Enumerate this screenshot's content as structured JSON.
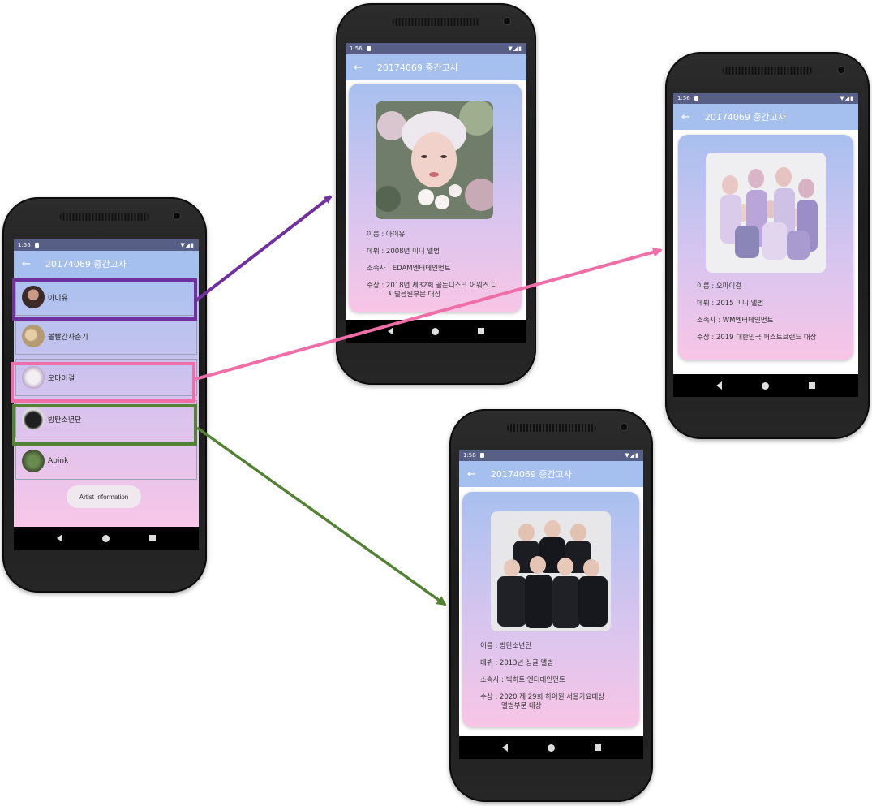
{
  "main": {
    "status_time": "1:56",
    "title": "20174069 중간고사",
    "items": [
      {
        "label": "아이유"
      },
      {
        "label": "볼빨간사춘기"
      },
      {
        "label": "오마이걸"
      },
      {
        "label": "방탄소년단"
      },
      {
        "label": "Apink"
      }
    ],
    "button_label": "Artist Information"
  },
  "detail_iu": {
    "status_time": "1:56",
    "title": "20174069 중간고사",
    "name": "이름 : 아이유",
    "debut": "데뷔 : 2008년 미니 앨범",
    "agency": "소속사 : EDAM엔터테인먼트",
    "award_1": "수상 : 2018년 제32회 골든디스크 어워즈 디",
    "award_2": "지털음원부문 대상"
  },
  "detail_ohmygirl": {
    "status_time": "1:56",
    "title": "20174069 중간고사",
    "name": "이름 : 오마이걸",
    "debut": "데뷔 : 2015 미니 앨범",
    "agency": "소속사 : WM엔터테인먼트",
    "award_1": "수상 : 2019 대한민국 퍼스트브랜드 대상"
  },
  "detail_bts": {
    "status_time": "1:58",
    "title": "20174069 중간고사",
    "name": "이름 : 방탄소년단",
    "debut": "데뷔 : 2013년 싱글 앨범",
    "agency": "소속사 : 빅히트 엔터테인먼트",
    "award_1": "수상 : 2020 제 29회 하이원 서울가요대상",
    "award_2": "앨범부문 대상"
  },
  "colors": {
    "appbar": "#a5c0ef",
    "highlight_purple": "#7030a0",
    "highlight_pink": "#f06ea8",
    "highlight_green": "#548235"
  }
}
